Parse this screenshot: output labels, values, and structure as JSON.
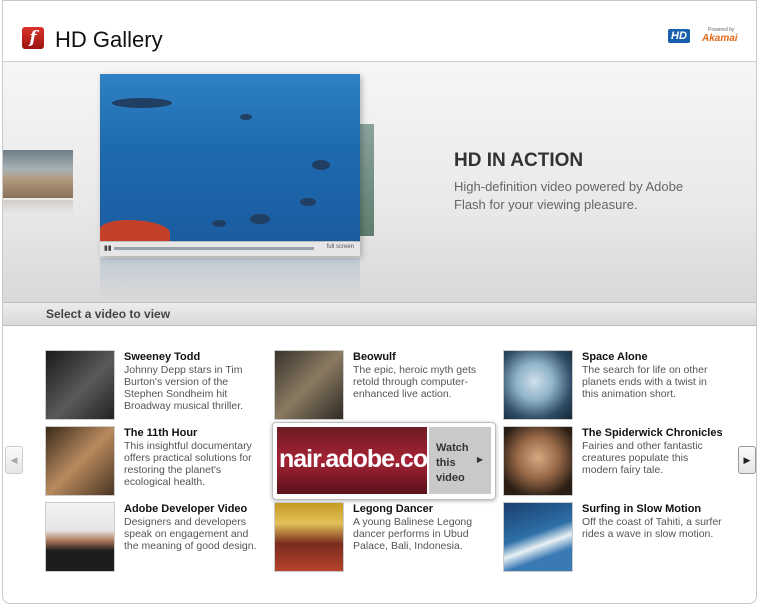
{
  "app": {
    "title": "HD Gallery"
  },
  "badge": {
    "hd": "HD",
    "powered": "Powered by",
    "brand": "Akamai"
  },
  "hero": {
    "heading": "HD IN ACTION",
    "description": "High-definition video powered by Adobe Flash for your viewing pleasure.",
    "player_label": "full screen"
  },
  "select_bar": {
    "label": "Select a video to view"
  },
  "selected": {
    "video_text": "nair.adobe.com",
    "watch_label": "Watch this video"
  },
  "videos": [
    {
      "title": "Sweeney Todd",
      "desc": "Johnny Depp stars in Tim Burton's version of the Stephen Sondheim hit Broadway musical thriller."
    },
    {
      "title": "Beowulf",
      "desc": "The epic, heroic myth gets retold through computer-enhanced live action."
    },
    {
      "title": "Space Alone",
      "desc": "The search for life on other planets ends with a twist in this animation short."
    },
    {
      "title": "The 11th Hour",
      "desc": "This insightful documentary offers practical solutions for restoring the planet's ecological health."
    },
    {
      "title": "The Spiderwick Chronicles",
      "desc": "Fairies and other fantastic creatures populate this modern fairy tale."
    },
    {
      "title": "Adobe Developer Video",
      "desc": "Designers and developers speak on engagement and the meaning of good design."
    },
    {
      "title": "Legong Dancer",
      "desc": "A young Balinese Legong dancer performs in Ubud Palace, Bali, Indonesia."
    },
    {
      "title": "Surfing in Slow Motion",
      "desc": "Off the coast of Tahiti, a surfer rides a wave in slow motion."
    }
  ]
}
